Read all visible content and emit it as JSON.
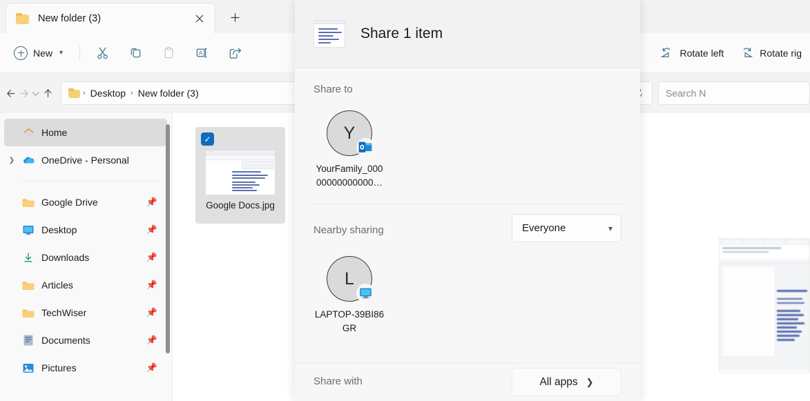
{
  "window": {
    "tab": {
      "title": "New folder (3)",
      "folder_icon": "folder-icon",
      "close_icon": "close-icon"
    },
    "new_tab_icon": "plus-icon"
  },
  "toolbar": {
    "new_label": "New",
    "new_chevron": "chevron-down-icon",
    "items": [
      {
        "name": "cut-button",
        "icon": "scissors-icon"
      },
      {
        "name": "copy-button",
        "icon": "copy-icon"
      },
      {
        "name": "paste-button",
        "icon": "paste-icon"
      },
      {
        "name": "rename-button",
        "icon": "rename-icon"
      },
      {
        "name": "share-button",
        "icon": "share-icon"
      }
    ],
    "rotate_left_label": "Rotate left",
    "rotate_right_label": "Rotate rig",
    "rotate_left_icon": "rotate-left-icon",
    "rotate_right_icon": "rotate-right-icon"
  },
  "addressbar": {
    "back_icon": "arrow-left-icon",
    "forward_icon": "arrow-right-icon",
    "recent_icon": "chevron-down-icon",
    "up_icon": "arrow-up-icon",
    "folder_icon": "folder-icon",
    "crumbs": [
      "Desktop",
      "New folder (3)"
    ],
    "separator": "›",
    "dropdown_icon": "chevron-down-icon",
    "refresh_icon": "refresh-icon",
    "search_placeholder": "Search N"
  },
  "sidebar": {
    "items": [
      {
        "label": "Home",
        "icon": "home-icon",
        "selected": true,
        "expandable": false,
        "pinned": false
      },
      {
        "label": "OneDrive - Personal",
        "icon": "onedrive-icon",
        "selected": false,
        "expandable": true,
        "pinned": false
      },
      {
        "label": "Google Drive",
        "icon": "folder-icon",
        "selected": false,
        "expandable": false,
        "pinned": true
      },
      {
        "label": "Desktop",
        "icon": "desktop-icon",
        "selected": false,
        "expandable": false,
        "pinned": true
      },
      {
        "label": "Downloads",
        "icon": "downloads-icon",
        "selected": false,
        "expandable": false,
        "pinned": true
      },
      {
        "label": "Articles",
        "icon": "folder-icon",
        "selected": false,
        "expandable": false,
        "pinned": true
      },
      {
        "label": "TechWiser",
        "icon": "folder-icon",
        "selected": false,
        "expandable": false,
        "pinned": true
      },
      {
        "label": "Documents",
        "icon": "documents-icon",
        "selected": false,
        "expandable": false,
        "pinned": true
      },
      {
        "label": "Pictures",
        "icon": "pictures-icon",
        "selected": false,
        "expandable": false,
        "pinned": true
      }
    ],
    "pin_icon": "pin-icon",
    "expand_icon": "chevron-right-icon"
  },
  "files": [
    {
      "name": "Google Docs.jpg",
      "selected": true,
      "check_icon": "check-icon",
      "thumbnail": "document-thumbnail"
    }
  ],
  "share_dialog": {
    "title": "Share 1 item",
    "header_thumbnail": "document-thumbnail",
    "share_to_label": "Share to",
    "contacts": [
      {
        "initial": "Y",
        "name_line1": "YourFamily_000",
        "name_line2": "00000000000…",
        "badge": "outlook-icon"
      }
    ],
    "nearby_label": "Nearby sharing",
    "nearby_dropdown_value": "Everyone",
    "nearby_dropdown_icon": "chevron-down-icon",
    "devices": [
      {
        "initial": "L",
        "name_line1": "LAPTOP-39BI86",
        "name_line2": "GR",
        "badge": "monitor-icon"
      }
    ],
    "share_with_label": "Share with",
    "all_apps_label": "All apps",
    "all_apps_icon": "chevron-right-icon"
  },
  "colors": {
    "accent": "#0f6cbd",
    "folder_yellow": "#f7d07a",
    "selected_nav": "#dcdcdc"
  }
}
